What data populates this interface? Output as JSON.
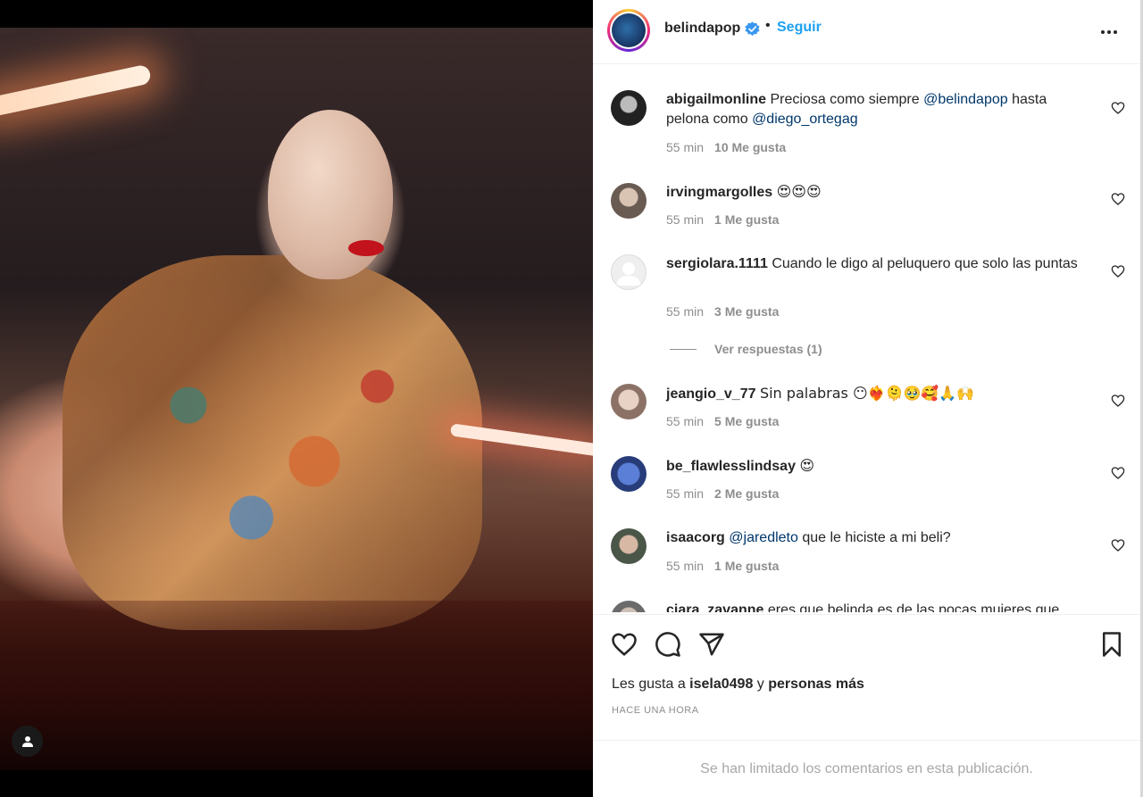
{
  "post": {
    "author": "belindapop",
    "follow_label": "Seguir",
    "separator": "•"
  },
  "comments": [
    {
      "user": "abigailmonline",
      "parts": [
        "Preciosa como siempre ",
        "@belindapop",
        " hasta pelona como ",
        "@diego_ortegag"
      ],
      "time": "55 min",
      "likes": "10 Me gusta"
    },
    {
      "user": "irvingmargolles",
      "text": "😍😍😍",
      "time": "55 min",
      "likes": "1 Me gusta"
    },
    {
      "user": "sergiolara.1111",
      "text": "Cuando le digo al peluquero que solo las puntas",
      "time": "55 min",
      "likes": "3 Me gusta"
    },
    {
      "user": "jeangio_v_77",
      "text": "Sin palabras 😶❤️‍🔥🫠🥹🥰🙏🙌",
      "time": "55 min",
      "likes": "5 Me gusta"
    },
    {
      "user": "be_flawlesslindsay",
      "text": "😍",
      "time": "55 min",
      "likes": "2 Me gusta"
    },
    {
      "user": "isaacorg",
      "mention": "@jaredleto",
      "text": " que le hiciste a mi beli?",
      "time": "55 min",
      "likes": "1 Me gusta"
    },
    {
      "user": "ciara_zavanne",
      "text": "eres que belinda es de las pocas mujeres que"
    }
  ],
  "replies_label": "Ver respuestas (1)",
  "likes_summary": {
    "prefix": "Les gusta a ",
    "user": "isela0498",
    "middle": " y ",
    "rest": "personas más"
  },
  "time_ago": "HACE UNA HORA",
  "comments_limited": "Se han limitado los comentarios en esta publicación."
}
